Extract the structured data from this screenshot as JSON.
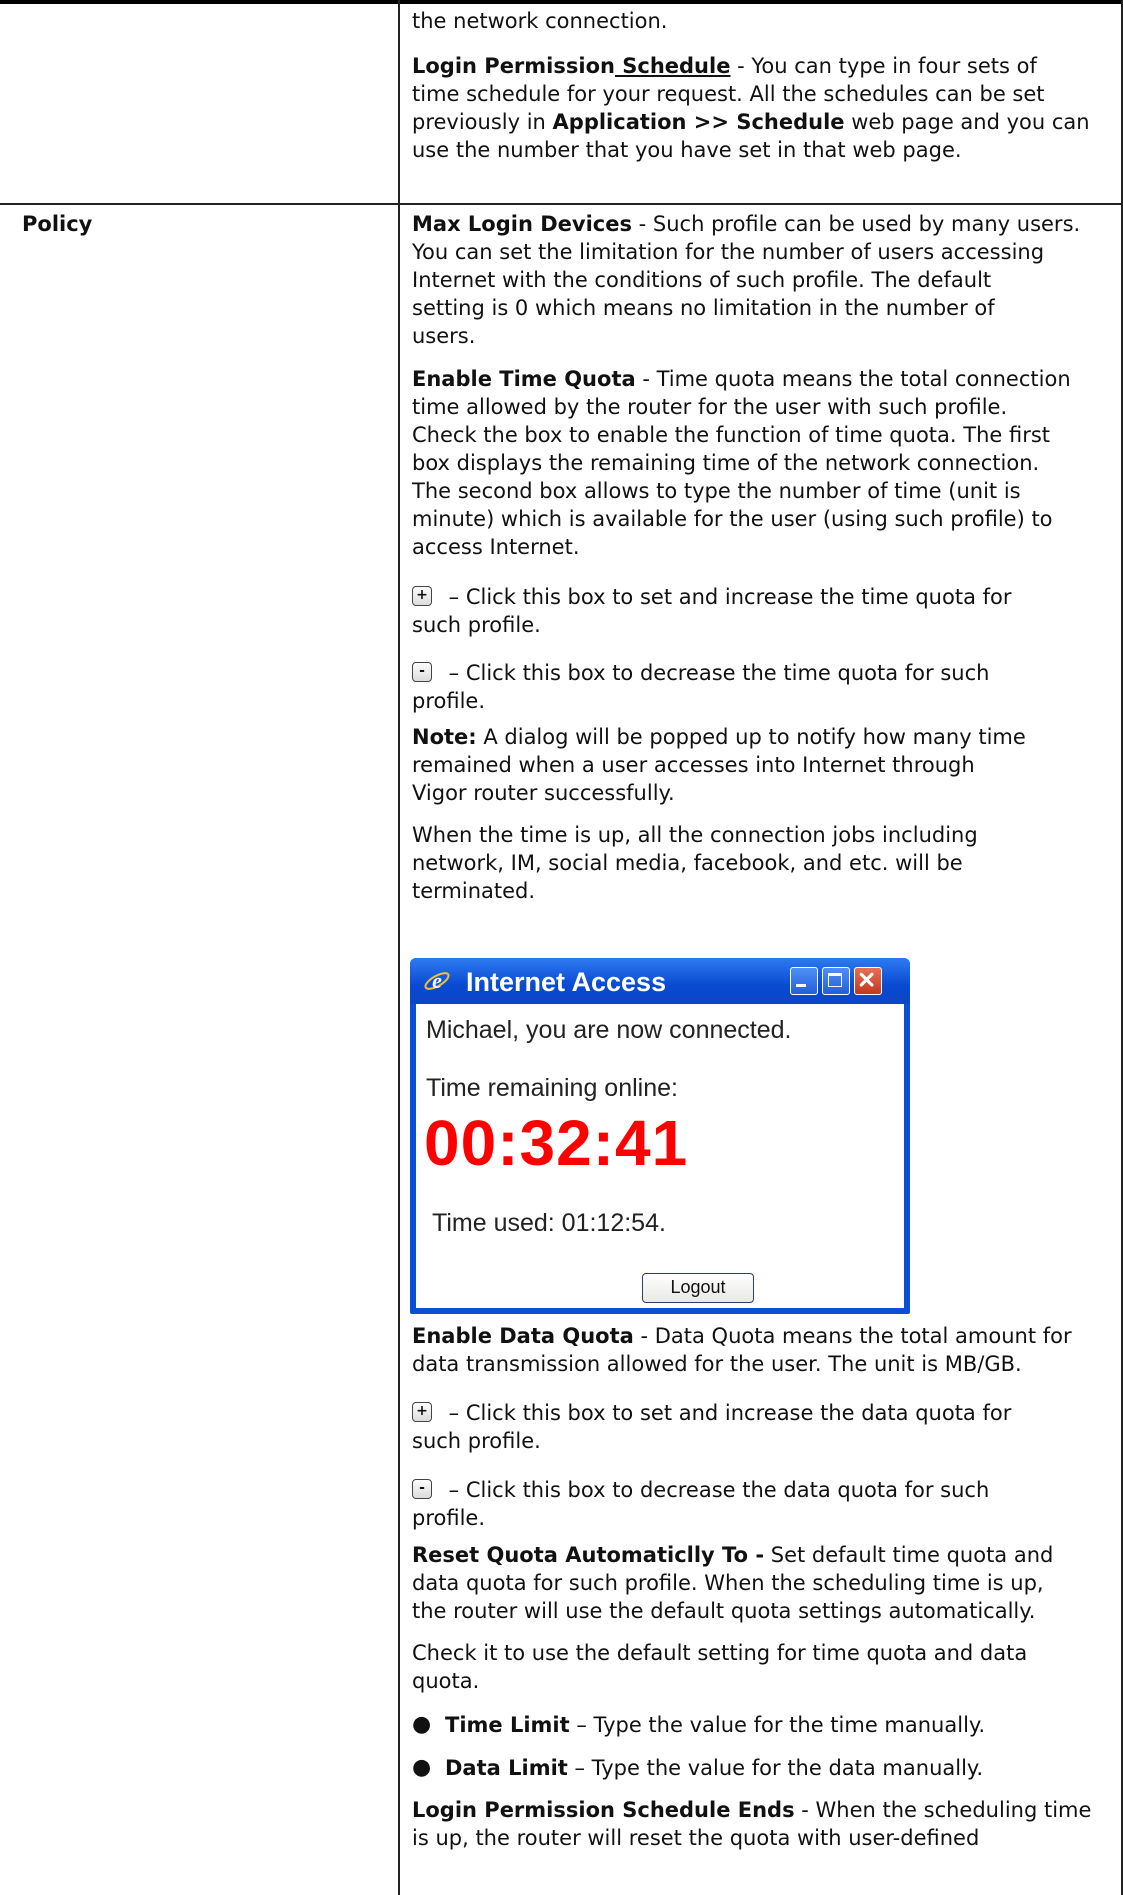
{
  "top_block": {
    "l1": "the network connection.",
    "l2_bold": "Login Permission",
    "l2_bold_u": " Schedule",
    "l2_rest": " - You can type in four sets of",
    "l3": "time schedule for your request. All the schedules can be set",
    "l4_pre": "previously in ",
    "l4_b1": "Application",
    "l4_mid": " >> ",
    "l4_b2": "Schedule",
    "l4_rest": " web page and you can",
    "l5": "use the number that you have set in that web page."
  },
  "policy": {
    "label": "Policy",
    "max_login": {
      "term": "Max Login Devices",
      "lines": [
        " - Such profile can be used by many users.",
        "You can set the limitation for the number of users accessing",
        "Internet with the conditions of such profile. The default",
        "setting is 0 which means no limitation in the number of",
        "users."
      ]
    },
    "time_quota": {
      "term": "Enable Time Quota",
      "lines": [
        " - Time quota means the total connection",
        "time allowed by the router for the user with such profile.",
        "Check the box to enable the function of time quota. The first",
        "box displays the remaining time of the network connection.",
        "The second box allows to type the number of time (unit is",
        "minute) which is available for the user (using such profile) to",
        "access Internet."
      ],
      "plus_l1": " – Click this box to set and increase the time quota for",
      "plus_l2": "such profile.",
      "minus_l1": " – Click this box to decrease the time quota for such",
      "minus_l2": "profile."
    },
    "note": {
      "term": "Note:",
      "l1": " A dialog will be popped up to notify how many time",
      "l2": "remained when a user accesses into Internet through",
      "l3": "Vigor router successfully."
    },
    "timeup": {
      "l1": "When the time is up, all the connection jobs including",
      "l2": "network, IM, social media, facebook, and etc. will be",
      "l3": "terminated."
    },
    "popup": {
      "title": "Internet Access",
      "connected": "Michael, you are now connected.",
      "remaining_label": "Time remaining online:",
      "remaining_value": "00:32:41",
      "used": "Time used: 01:12:54.",
      "logout": "Logout",
      "colors": {
        "titlebar": "#0b4fd6",
        "countdown": "#ff0000",
        "close": "#d9502f"
      }
    },
    "data_quota": {
      "term": "Enable Data Quota",
      "l1": " - Data Quota means the total amount for",
      "l2": "data transmission allowed for the user. The unit is MB/GB.",
      "plus_l1": " – Click this box to set and increase the data quota for",
      "plus_l2": "such profile.",
      "minus_l1": " – Click this box to decrease the data quota for such",
      "minus_l2": "profile."
    },
    "reset": {
      "term": "Reset Quota Automaticlly To -",
      "l1": " Set default time quota and",
      "l2": "data quota for such profile. When the scheduling time is up,",
      "l3": "the router will use the default quota settings automatically.",
      "l4": "Check it to use the default setting for time quota and data",
      "l5": "quota."
    },
    "bullets": [
      {
        "term": "Time Limit",
        "text": " – Type the value for the time manually."
      },
      {
        "term": "Data Limit",
        "text": " – Type the value for the data manually."
      }
    ],
    "schedule_ends": {
      "term": "Login Permission Schedule Ends",
      "l1": " - When the scheduling time",
      "l2": "is up, the router will reset the quota with user-defined"
    },
    "icons": {
      "plus": "plus-button-icon",
      "minus": "minus-button-icon",
      "bullet": "bullet-dot-icon"
    }
  }
}
